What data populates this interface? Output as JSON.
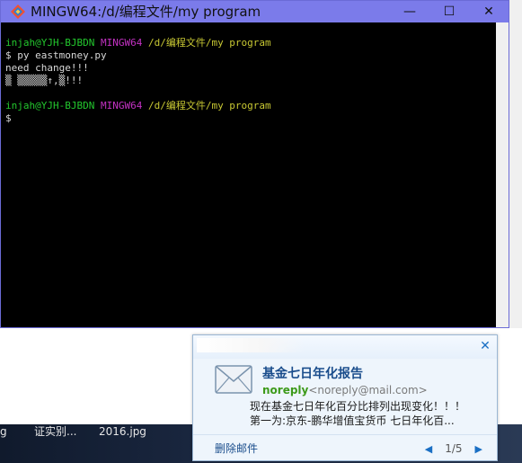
{
  "terminal": {
    "title": "MINGW64:/d/编程文件/my program",
    "controls": {
      "minimize": "—",
      "maximize": "☐",
      "close": "✕"
    },
    "lines": [
      {
        "user": "injah@YJH-BJBDN",
        "env": "MINGW64",
        "path": "/d/编程文件/my program"
      },
      {
        "text": "$ py eastmoney.py"
      },
      {
        "text": "need change!!!"
      },
      {
        "text": "▒ ▒▒▒▒▒↑,▒!!!"
      },
      {
        "user": "injah@YJH-BJBDN",
        "env": "MINGW64",
        "path": "/d/编程文件/my program"
      },
      {
        "text": "$"
      }
    ]
  },
  "desktop": {
    "labels": [
      "g",
      "证实别...",
      "2016.jpg"
    ]
  },
  "notification": {
    "close": "✕",
    "subject": "基金七日年化报告",
    "sender_name": "noreply",
    "sender_email": "<noreply@mail.com>",
    "body_line1": "现在基金七日年化百分比排列出现变化！！！",
    "body_line2": "第一为:京东-鹏华增值宝货币 七日年化百...",
    "delete_label": "删除邮件",
    "pager_text": "1/5",
    "prev": "◀",
    "next": "▶"
  },
  "colors": {
    "titlebar": "#7b7bea",
    "prompt_user": "#23c82e",
    "prompt_env": "#c432c4",
    "prompt_path": "#c8c833"
  }
}
